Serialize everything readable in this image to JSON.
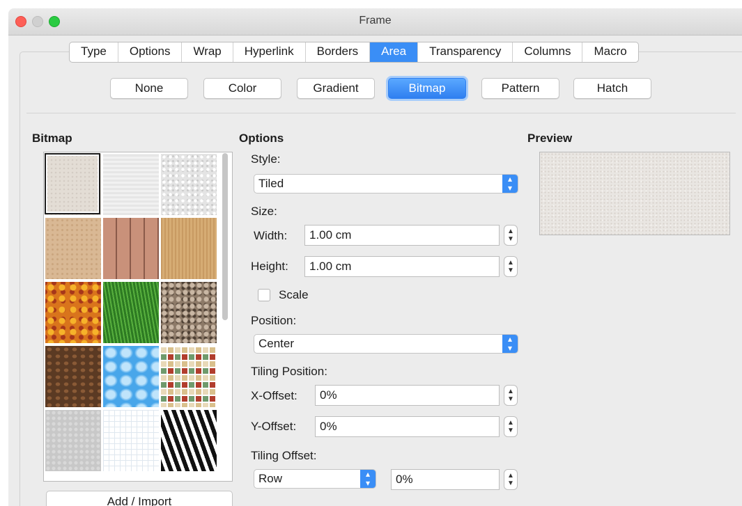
{
  "window": {
    "title": "Frame"
  },
  "tabs": [
    "Type",
    "Options",
    "Wrap",
    "Hyperlink",
    "Borders",
    "Area",
    "Transparency",
    "Columns",
    "Macro"
  ],
  "active_tab": "Area",
  "fill_buttons": [
    "None",
    "Color",
    "Gradient",
    "Bitmap",
    "Pattern",
    "Hatch"
  ],
  "active_fill": "Bitmap",
  "bitmap": {
    "heading": "Bitmap",
    "add_import_label": "Add / Import"
  },
  "options": {
    "heading": "Options",
    "style_label": "Style:",
    "style_value": "Tiled",
    "size_label": "Size:",
    "width_label": "Width:",
    "width_value": "1.00 cm",
    "height_label": "Height:",
    "height_value": "1.00 cm",
    "scale_label": "Scale",
    "position_label": "Position:",
    "position_value": "Center",
    "tiling_position_label": "Tiling Position:",
    "x_offset_label": "X-Offset:",
    "x_offset_value": "0%",
    "y_offset_label": "Y-Offset:",
    "y_offset_value": "0%",
    "tiling_offset_label": "Tiling Offset:",
    "tiling_offset_mode": "Row",
    "tiling_offset_value": "0%"
  },
  "preview": {
    "heading": "Preview"
  },
  "colors": {
    "accent": "#3a8ef6",
    "close": "#fd5f57",
    "maximize": "#2acb42"
  }
}
